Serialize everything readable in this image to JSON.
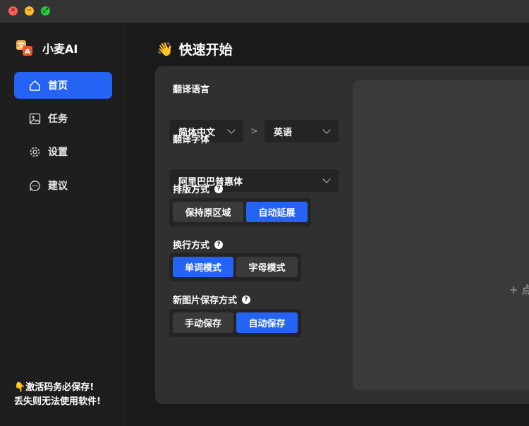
{
  "window": {
    "close_glyph": "✕",
    "minimize_glyph": "−",
    "maximize_glyph": "⤢"
  },
  "brand": {
    "name": "小麦AI",
    "logo_icon": "translate-icon"
  },
  "nav": {
    "items": [
      {
        "label": "首页",
        "icon": "home-icon",
        "active": true
      },
      {
        "label": "任务",
        "icon": "image-icon",
        "active": false
      },
      {
        "label": "设置",
        "icon": "gear-icon",
        "active": false
      },
      {
        "label": "建议",
        "icon": "chat-icon",
        "active": false
      }
    ]
  },
  "warning": {
    "icon": "👇",
    "line1": "激活码务必保存!",
    "line2": "丢失则无法使用软件!"
  },
  "page": {
    "wave_icon": "👋",
    "title": "快速开始"
  },
  "settings": {
    "language": {
      "label": "翻译语言",
      "source": "简体中文",
      "separator": ">",
      "target": "英语"
    },
    "font": {
      "label": "翻译字体",
      "value": "阿里巴巴普惠体"
    },
    "layout": {
      "label": "排版方式",
      "help": "?",
      "options": [
        "保持原区域",
        "自动延展"
      ],
      "selected": "自动延展"
    },
    "wrap": {
      "label": "换行方式",
      "help": "?",
      "options": [
        "单词模式",
        "字母模式"
      ],
      "selected": "单词模式"
    },
    "save": {
      "label": "新图片保存方式",
      "help": "?",
      "options": [
        "手动保存",
        "自动保存"
      ],
      "selected": "自动保存"
    }
  },
  "dropzone": {
    "text": "+ 点"
  },
  "colors": {
    "accent": "#2563f5",
    "card": "#303030",
    "sidebar": "#1e1e1e",
    "control": "#242424"
  }
}
